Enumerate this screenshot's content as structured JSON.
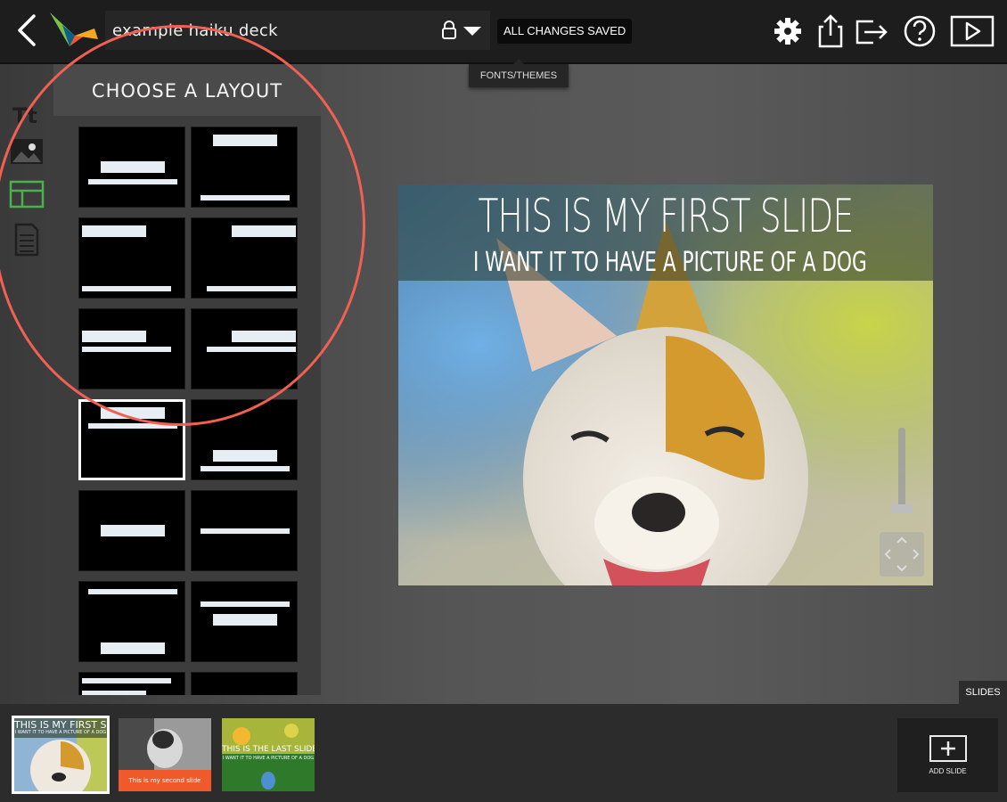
{
  "header": {
    "deck_title": "example haiku deck",
    "save_status": "ALL CHANGES SAVED",
    "fonts_tooltip": "FONTS/THEMES"
  },
  "toolbar": {
    "icons": [
      "back-icon",
      "logo",
      "lock-icon",
      "caret-down-icon",
      "gear-icon",
      "share-icon",
      "exit-icon",
      "help-icon",
      "play-icon"
    ]
  },
  "rail": {
    "icons": [
      "text-icon",
      "image-icon",
      "layout-icon",
      "notes-icon"
    ],
    "active": "layout-icon",
    "active_color": "#4caf50"
  },
  "layout_panel": {
    "title": "CHOOSE A LAYOUT",
    "layouts": [
      "center-title-bottom-line",
      "top-title-bottom-line",
      "left-title-bottom-line",
      "right-title-bottom-line",
      "left-title-left-line",
      "right-title-right-line",
      "top-center-title-line",
      "bottom-center-title-line",
      "center-title-only",
      "center-line-only",
      "top-line-bottom-title",
      "top-two-lines",
      "top-lines-partial",
      "empty-partial"
    ],
    "selected_index": 6
  },
  "slide": {
    "title": "THIS IS MY FIRST SLIDE",
    "subtitle": "I WANT IT TO HAVE A PICTURE OF A DOG"
  },
  "tray": {
    "tab_label": "SLIDES",
    "add_label": "ADD SLIDE",
    "slides": [
      {
        "title": "THIS IS MY FIRST SLIDE",
        "subtitle": "I WANT IT TO HAVE A PICTURE OF A DOG",
        "selected": true
      },
      {
        "title": "This is my second slide",
        "selected": false
      },
      {
        "title": "THIS IS THE LAST SLIDE",
        "subtitle": "I WANT IT TO HAVE A PICTURE OF A DOG",
        "selected": false
      }
    ]
  },
  "colors": {
    "annotation": "#f06154",
    "accent_orange": "#f05a2a"
  }
}
